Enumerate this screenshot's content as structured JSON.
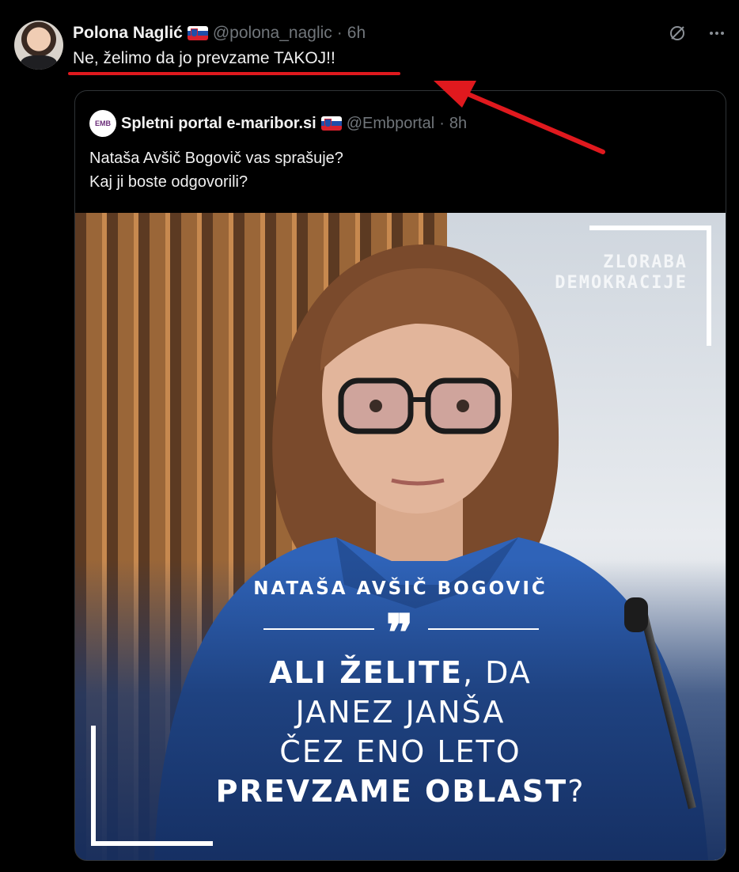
{
  "tweet": {
    "display_name": "Polona Naglić",
    "handle": "@polona_naglic",
    "separator": "·",
    "time": "6h",
    "text": "Ne, želimo da jo prevzame TAKOJ!!"
  },
  "quoted": {
    "display_name": "Spletni portal e-maribor.si",
    "handle": "@Embportal",
    "separator": "·",
    "time": "8h",
    "avatar_text": "EMB",
    "text_line1": "Nataša Avšič Bogovič vas sprašuje?",
    "text_line2": "Kaj ji boste odgovorili?",
    "image": {
      "brand_line1": "ZLORABA",
      "brand_line2": "DEMOKRACIJE",
      "subject": "NATAŠA AVŠIČ BOGOVIČ",
      "quote_mark": "❞",
      "line1_bold": "ALI ŽELITE",
      "line1_rest": ", DA",
      "line2": "JANEZ JANŠA",
      "line3": "ČEZ ENO LETO",
      "line4_bold": "PREVZAME OBLAST",
      "line4_rest": "?"
    }
  },
  "icons": {
    "grok": "grok-icon",
    "more": "more-icon"
  },
  "colors": {
    "background": "#000000",
    "text": "#e7e9ea",
    "muted": "#71767b",
    "annotation_red": "#e0191e",
    "border": "#2f3336"
  }
}
